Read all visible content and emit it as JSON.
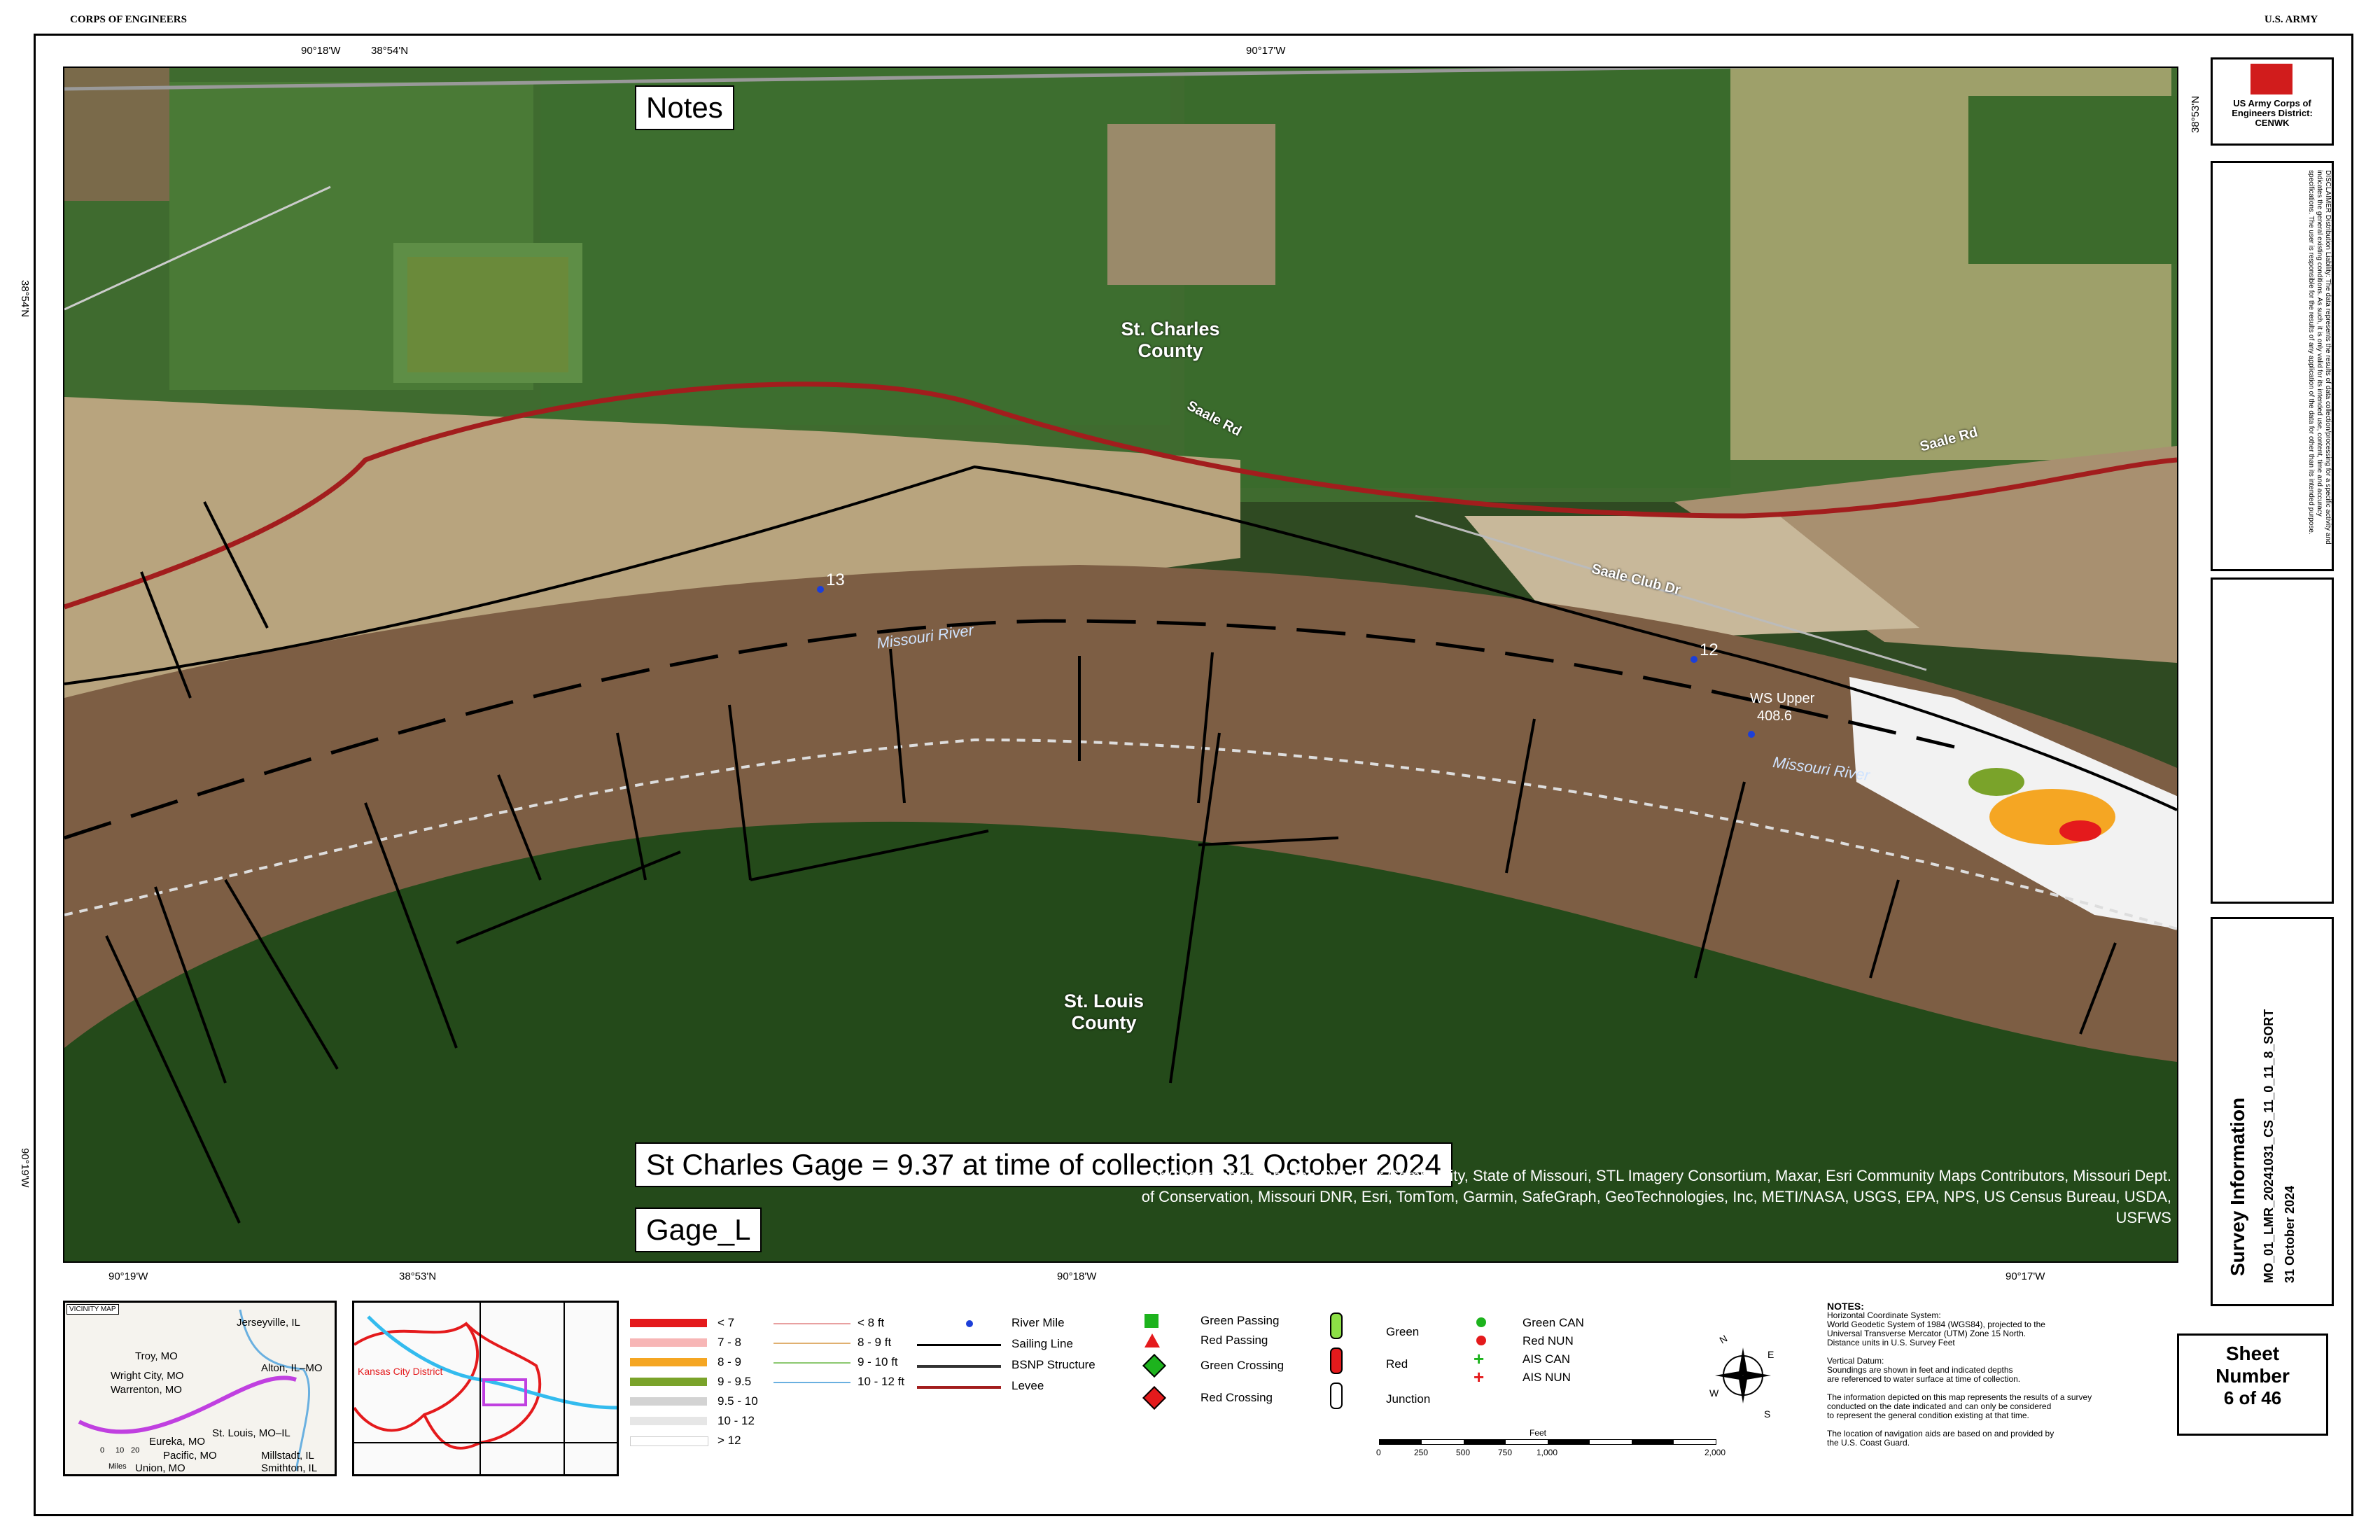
{
  "header": {
    "left": "CORPS OF ENGINEERS",
    "right": "U.S. ARMY"
  },
  "map": {
    "top_coords": [
      "90°18'W",
      "38°54'N",
      "90°17'W"
    ],
    "bottom_coords": [
      "90°19'W",
      "38°53'N",
      "90°18'W",
      "90°17'W"
    ],
    "left_coords": [
      "38°54'N",
      "90°19'W"
    ],
    "right_coords": [
      "38°53'N"
    ],
    "labels": {
      "st_charles_county": "St. Charles County",
      "st_louis_county": "St. Louis County",
      "missouri_river": "Missouri River",
      "missouri_river_2": "Missouri River",
      "saale_rd": "Saale Rd",
      "saale_rd_2": "Saale Rd",
      "saale_club_dr": "Saale Club Dr",
      "rm13": "13",
      "rm12": "12",
      "ws_upper": "WS Upper",
      "ws_value": "408.6"
    },
    "notes_box": "Notes",
    "gage_box": "St Charles Gage = 9.37 at time of collection 31 October 2024",
    "gage_l_box": "Gage_L",
    "attribution": "er Geographics, and the GIS User Community, State of Missouri, STL Imagery Consortium, Maxar, Esri Community Maps Contributors, Missouri Dept. of Conservation, Missouri DNR, Esri, TomTom, Garmin, SafeGraph, GeoTechnologies, Inc, METI/NASA, USGS, EPA, NPS, US Census Bureau, USDA, USFWS"
  },
  "titleblock": {
    "agency": "US Army Corps of Engineers District: CENWK",
    "disclaimer": "DISCLAIMER Distribution Liability: The data represents the results of data collection/processing for a specific activity and indicates the general existing conditions. As such, it is only valid for its intended use, content, time and accuracy specifications. The user is responsible for the results of any application of the data for other than its intended purpose.",
    "survey_title": "Survey Information",
    "survey_file": "MO_01_LMR_20241031_CS_11_0_11_8_SORT",
    "survey_date": "31 October 2024",
    "sheet_label": "Sheet Number",
    "sheet_value": "6 of 46"
  },
  "vicinity": {
    "title": "VICINITY MAP",
    "places": [
      "Jerseyville, IL",
      "Troy, MO",
      "Alton, IL–MO",
      "Wright City, MO",
      "Warrenton, MO",
      "St. Louis, MO–IL",
      "Eureka, MO",
      "Pacific, MO",
      "Millstadt, IL",
      "Union, MO",
      "Smithton, IL"
    ],
    "scale": [
      "0",
      "10",
      "20"
    ],
    "scale_unit": "Miles"
  },
  "district_map": {
    "label": "Kansas City District"
  },
  "legend": {
    "depth_items": [
      {
        "label": "< 7",
        "color": "#e41a1c"
      },
      {
        "label": "7 - 8",
        "color": "#f7b6b6"
      },
      {
        "label": "8 - 9",
        "color": "#f5a623"
      },
      {
        "label": "9 - 9.5",
        "color": "#7aa32a"
      },
      {
        "label": "9.5 - 10",
        "color": "#d3d3d3"
      },
      {
        "label": "10 - 12",
        "color": "#e6e6e6"
      },
      {
        "label": "> 12",
        "color": "#ffffff"
      }
    ],
    "contour_items": [
      {
        "label": "< 8 ft",
        "color": "#e8a0a0"
      },
      {
        "label": "8 - 9 ft",
        "color": "#e0b070"
      },
      {
        "label": "9 - 10 ft",
        "color": "#8cc870"
      },
      {
        "label": "10 - 12 ft",
        "color": "#6ab0e0"
      }
    ],
    "line_items": [
      "River Mile",
      "Sailing Line",
      "BSNP Structure",
      "Levee"
    ],
    "nav_items": [
      "Green Passing",
      "Red Passing",
      "Green Crossing",
      "Red Crossing"
    ],
    "buoy_items": [
      "Green",
      "Red",
      "Junction"
    ],
    "ais_items": [
      "Green CAN",
      "Red NUN",
      "AIS CAN",
      "AIS NUN"
    ]
  },
  "scalebar": {
    "unit": "Feet",
    "ticks": [
      "0",
      "250",
      "500",
      "750",
      "1,000",
      "2,000"
    ]
  },
  "notes": {
    "title": "NOTES:",
    "lines": [
      "Horizontal Coordinate System:",
      "World Geodetic System of 1984 (WGS84), projected to the",
      "Universal Transverse Mercator (UTM) Zone 15 North.",
      "Distance units in U.S. Survey Feet",
      "",
      "Vertical Datum:",
      "Soundings are shown in feet and indicated depths",
      "are referenced to water surface at time of collection.",
      "",
      "The information depicted on this map represents the results of a survey",
      "conducted on the date indicated and can only be considered",
      "to represent the general condition existing at that time.",
      "",
      "The location of navigation aids are based on and provided by",
      "the U.S. Coast Guard."
    ]
  }
}
